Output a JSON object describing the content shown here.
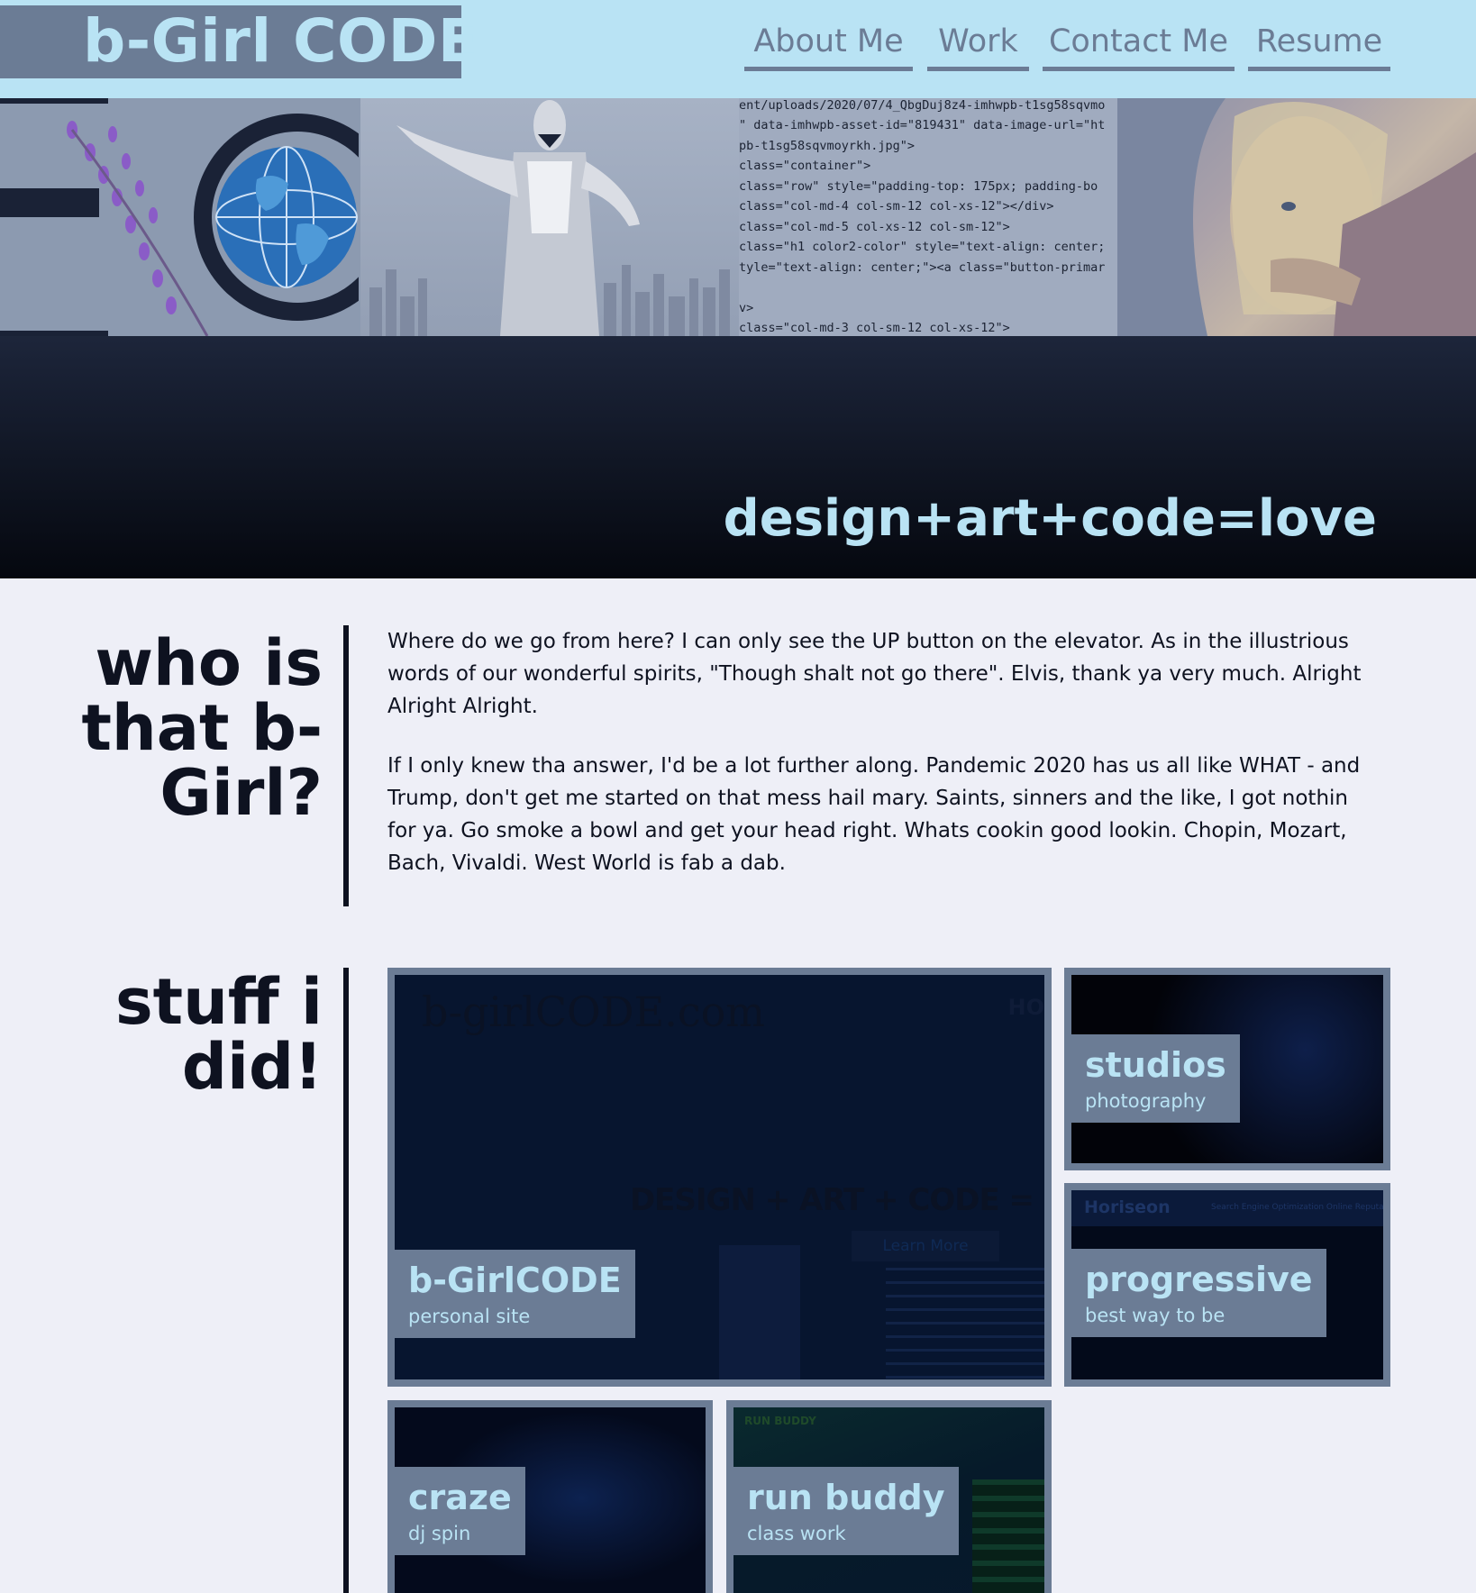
{
  "header": {
    "logo": "b-Girl CODE",
    "nav": [
      {
        "label": "About Me"
      },
      {
        "label": "Work"
      },
      {
        "label": "Contact Me"
      },
      {
        "label": "Resume"
      }
    ]
  },
  "hero": {
    "tagline": "design+art+code=love",
    "code_lines": [
      "ent/uploads/2020/07/4_QbgDuj8z4-imhwpb-t1sg58sqvmo",
      "\" data-imhwpb-asset-id=\"819431\" data-image-url=\"ht",
      "pb-t1sg58sqvmoyrkh.jpg\">",
      " class=\"container\">",
      " class=\"row\" style=\"padding-top: 175px; padding-bo",
      " class=\"col-md-4 col-sm-12 col-xs-12\"></div>",
      " class=\"col-md-5 col-xs-12 col-sm-12\">",
      "class=\"h1 color2-color\" style=\"text-align: center;",
      "tyle=\"text-align: center;\"><a class=\"button-primar",
      "",
      "v>",
      " class=\"col-md-3 col-sm-12 col-xs-12\">"
    ]
  },
  "about": {
    "title": "who is that b-Girl?",
    "paragraphs": [
      "Where do we go from here? I can only see the UP button on the elevator. As in the illustrious words of our wonderful spirits, \"Though shalt not go there\". Elvis, thank ya very much. Alright Alright Alright.",
      "If I only knew tha answer, I'd be a lot further along. Pandemic 2020 has us all like WHAT - and Trump, don't get me started on that mess hail mary. Saints, sinners and the like, I got nothin for ya. Go smoke a bowl and get your head right. Whats cookin good lookin. Chopin, Mozart, Bach, Vivaldi. West World is fab a dab."
    ]
  },
  "work": {
    "title": "stuff i did!",
    "projects": [
      {
        "title": "b-GirlCODE",
        "subtitle": "personal site",
        "preview_logo": "b-girlCODE.com",
        "preview_heading": "DESIGN + ART + CODE =",
        "preview_button": "Learn More",
        "preview_nav": "HO"
      },
      {
        "title": "studios",
        "subtitle": "photography"
      },
      {
        "title": "progressive",
        "subtitle": "best way to be",
        "preview_brand": "Horiseon",
        "preview_nav": "Search Engine Optimization    Online Reputation"
      },
      {
        "title": "craze",
        "subtitle": "dj spin"
      },
      {
        "title": "run buddy",
        "subtitle": "class work",
        "preview_brand": "RUN BUDDY"
      }
    ]
  },
  "colors": {
    "header_bg": "#b9e3f4",
    "accent": "#6b7c95",
    "page_bg": "#eeeff7",
    "text": "#0e1220"
  }
}
